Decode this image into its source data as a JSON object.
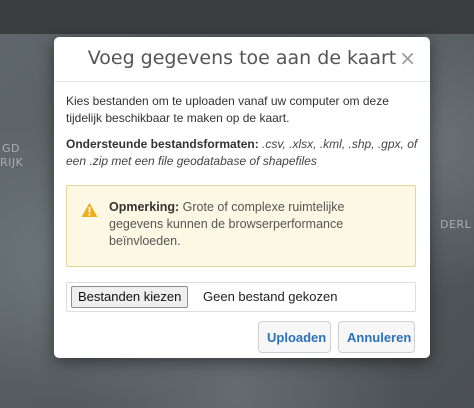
{
  "map": {
    "labels": [
      "GD",
      "RIJK",
      "DERL"
    ]
  },
  "dialog": {
    "title": "Voeg gegevens toe aan de kaart",
    "close_symbol": "×",
    "intro": "Kies bestanden om te uploaden vanaf uw computer om deze tijdelijk beschikbaar te maken op de kaart.",
    "formats_label": "Ondersteunde bestandsformaten:",
    "formats_text": ".csv, .xlsx, .kml, .shp, .gpx, of een .zip met een file geodatabase of shapefiles",
    "alert": {
      "icon": "warning-icon",
      "label": "Opmerking:",
      "text": "Grote of complexe ruimtelijke gegevens kunnen de browserperformance beïnvloeden."
    },
    "file_input": {
      "button_label": "Bestanden kiezen",
      "status": "Geen bestand gekozen"
    },
    "buttons": {
      "upload": "Uploaden",
      "cancel": "Annuleren"
    }
  },
  "colors": {
    "accent": "#2b72b8",
    "warning_bg": "#fcf8e3",
    "warning_icon": "#f0ad1e"
  }
}
